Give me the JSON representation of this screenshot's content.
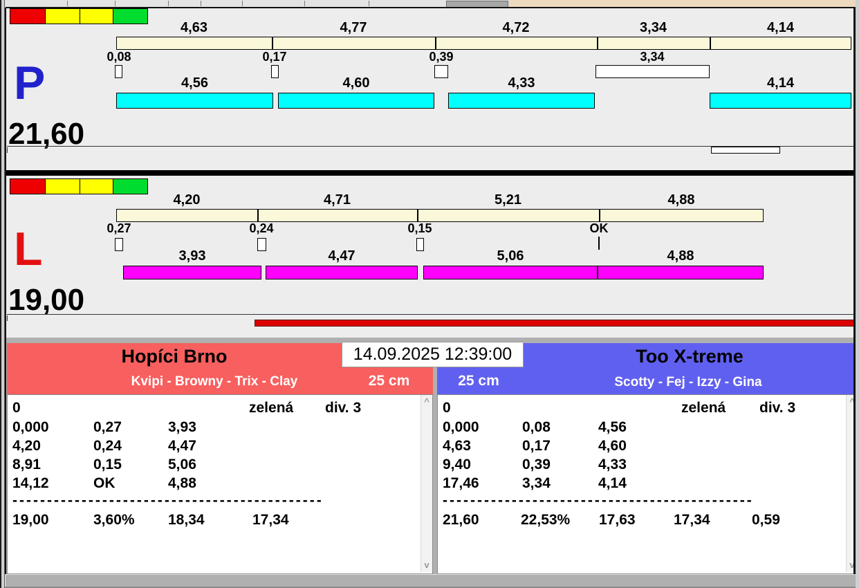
{
  "colors": {
    "accent_cyan": "#00ffff",
    "accent_magenta": "#ff00ff",
    "bar_cream": "#fbf8da",
    "team_left_header": "#f85f5f",
    "team_right_header": "#6060f0",
    "progress_red": "#dd0000",
    "lane_p_letter": "#2222cc",
    "lane_l_letter": "#e31010"
  },
  "status_lights": [
    "red",
    "yellow",
    "yellow",
    "green"
  ],
  "lane_p": {
    "letter": "P",
    "total": "21,60",
    "leg_times": [
      "4,63",
      "4,77",
      "4,72",
      "3,34",
      "4,14"
    ],
    "crossing_times": [
      "0,08",
      "0,17",
      "0,39",
      "3,34"
    ],
    "run_times": [
      "4,56",
      "4,60",
      "4,33",
      "4,14"
    ]
  },
  "lane_l": {
    "letter": "L",
    "total": "19,00",
    "leg_times": [
      "4,20",
      "4,71",
      "5,21",
      "4,88"
    ],
    "crossing_times": [
      "0,27",
      "0,24",
      "0,15",
      "OK"
    ],
    "run_times": [
      "3,93",
      "4,47",
      "5,06",
      "4,88"
    ]
  },
  "datetime": "14.09.2025 12:39:00",
  "team_left": {
    "name": "Hopíci Brno",
    "lineup": "Kvipi - Browny - Trix - Clay",
    "height_class": "25 cm",
    "info_row": [
      "0",
      "zelená",
      "div. 3"
    ],
    "rows": [
      [
        "0,000",
        "0,27",
        "3,93"
      ],
      [
        "4,20",
        "0,24",
        "4,47"
      ],
      [
        "8,91",
        "0,15",
        "5,06"
      ],
      [
        "14,12",
        "OK",
        "4,88"
      ]
    ],
    "separator": "---------------------------------------------",
    "summary": [
      "19,00",
      "3,60%",
      "18,34",
      "17,34"
    ]
  },
  "team_right": {
    "name": "Too X-treme",
    "lineup": "Scotty - Fej - Izzy - Gina",
    "height_class": "25 cm",
    "info_row": [
      "0",
      "zelená",
      "div. 3"
    ],
    "rows": [
      [
        "0,000",
        "0,08",
        "4,56"
      ],
      [
        "4,63",
        "0,17",
        "4,60"
      ],
      [
        "9,40",
        "0,39",
        "4,33"
      ],
      [
        "17,46",
        "3,34",
        "4,14"
      ]
    ],
    "separator": "---------------------------------------------",
    "summary": [
      "21,60",
      "22,53%",
      "17,63",
      "17,34",
      "0,59"
    ]
  },
  "scrollbar": {
    "up": "^",
    "down": "v"
  }
}
